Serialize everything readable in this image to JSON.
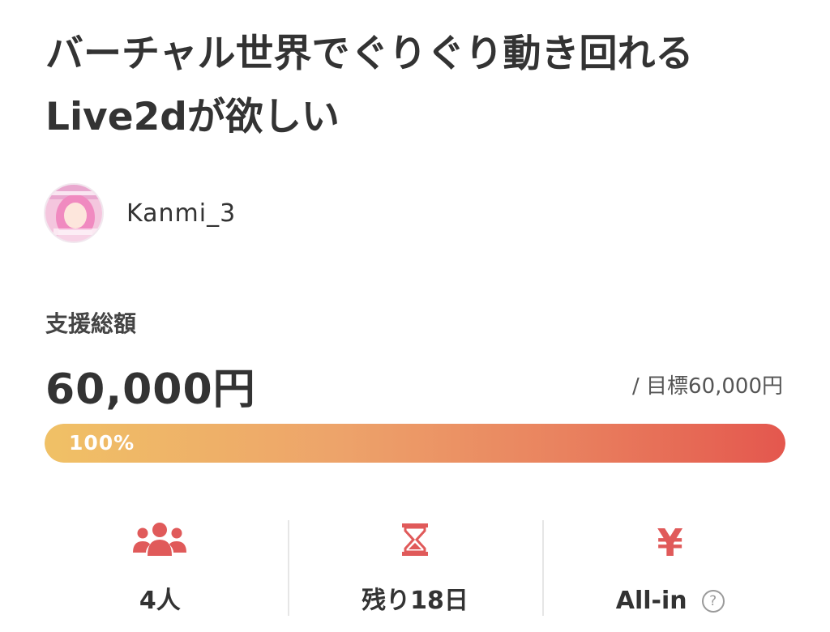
{
  "project": {
    "title": "バーチャル世界でぐりぐり動き回れるLive2dが欲しい",
    "owner": {
      "name": "Kanmi_3"
    }
  },
  "funding": {
    "total_label": "支援総額",
    "amount": "60,000円",
    "goal": "/ 目標60,000円",
    "progress_percent": 100,
    "progress_label": "100%"
  },
  "stats": {
    "supporters": {
      "icon": "supporters-icon",
      "value": "4人"
    },
    "remaining": {
      "icon": "hourglass-icon",
      "value": "残り18日"
    },
    "type": {
      "icon": "yen-icon",
      "symbol": "¥",
      "value": "All-in",
      "help_icon": "question-icon",
      "help_symbol": "?"
    }
  },
  "colors": {
    "accent": "#e05a5a",
    "progress_start": "#f0c166",
    "progress_end": "#e4574e",
    "text": "#333333"
  }
}
